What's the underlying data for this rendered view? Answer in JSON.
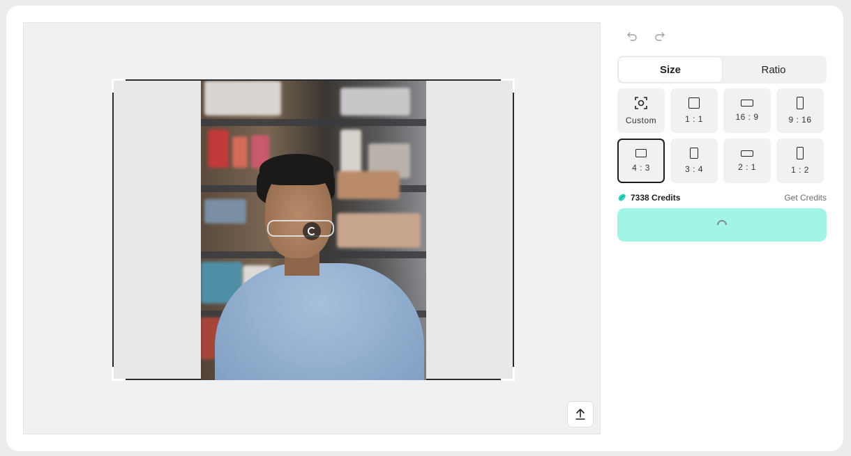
{
  "toolbar": {
    "undo_icon": "undo-icon",
    "redo_icon": "redo-icon"
  },
  "tabs": [
    {
      "label": "Size",
      "active": true
    },
    {
      "label": "Ratio",
      "active": false
    }
  ],
  "sizes": [
    {
      "label": "Custom",
      "icon": "custom-crop-icon"
    },
    {
      "label": "1 : 1",
      "icon": "ratio-1-1-icon"
    },
    {
      "label": "16 : 9",
      "icon": "ratio-16-9-icon"
    },
    {
      "label": "9 : 16",
      "icon": "ratio-9-16-icon"
    },
    {
      "label": "4 : 3",
      "icon": "ratio-4-3-icon",
      "selected": true
    },
    {
      "label": "3 : 4",
      "icon": "ratio-3-4-icon"
    },
    {
      "label": "2 : 1",
      "icon": "ratio-2-1-icon"
    },
    {
      "label": "1 : 2",
      "icon": "ratio-1-2-icon"
    }
  ],
  "credits": {
    "amount_label": "7338 Credits",
    "get_label": "Get Credits"
  },
  "colors": {
    "accent": "#a2f5e6",
    "credit_icon": "#2fd3c0",
    "selected_border": "#1d1d1f"
  }
}
